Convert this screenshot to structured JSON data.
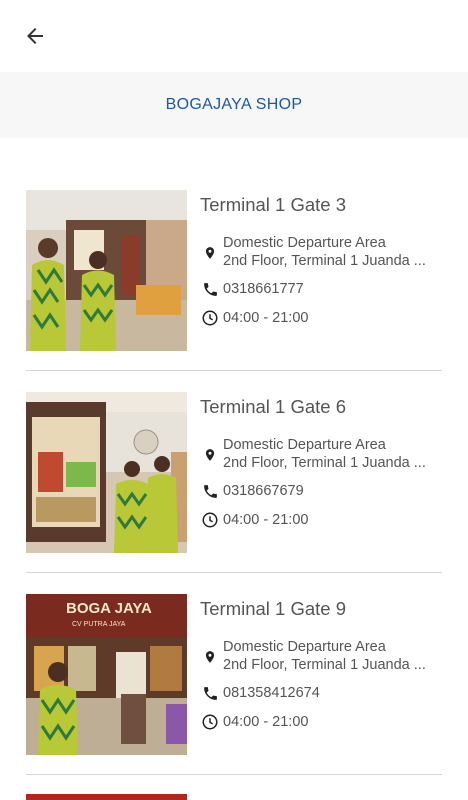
{
  "header": {
    "back_icon": "arrow-left-icon",
    "title": "BOGAJAYA SHOP",
    "title_color": "#1f56a8"
  },
  "shops": [
    {
      "name": "Terminal 1 Gate 3",
      "address_line1": "Domestic Departure Area",
      "address_line2": "2nd Floor, Terminal 1 Juanda ...",
      "phone": "0318661777",
      "hours": "04:00 - 21:00",
      "image": "shop-photo-staff-at-counter"
    },
    {
      "name": "Terminal 1 Gate 6",
      "address_line1": "Domestic Departure Area",
      "address_line2": "2nd Floor, Terminal 1 Juanda ...",
      "phone": "0318667679",
      "hours": "04:00 - 21:00",
      "image": "shop-photo-staff-by-display"
    },
    {
      "name": "Terminal 1 Gate 9",
      "address_line1": "Domestic Departure Area",
      "address_line2": "2nd Floor, Terminal 1 Juanda ...",
      "phone": "081358412674",
      "hours": "04:00 - 21:00",
      "image": "shop-photo-storefront",
      "sign_text": "BOGA JAYA",
      "sign_subtext": "CV PUTRA JAYA"
    }
  ],
  "icons": {
    "location": "location-pin-icon",
    "phone": "phone-icon",
    "clock": "clock-icon"
  }
}
